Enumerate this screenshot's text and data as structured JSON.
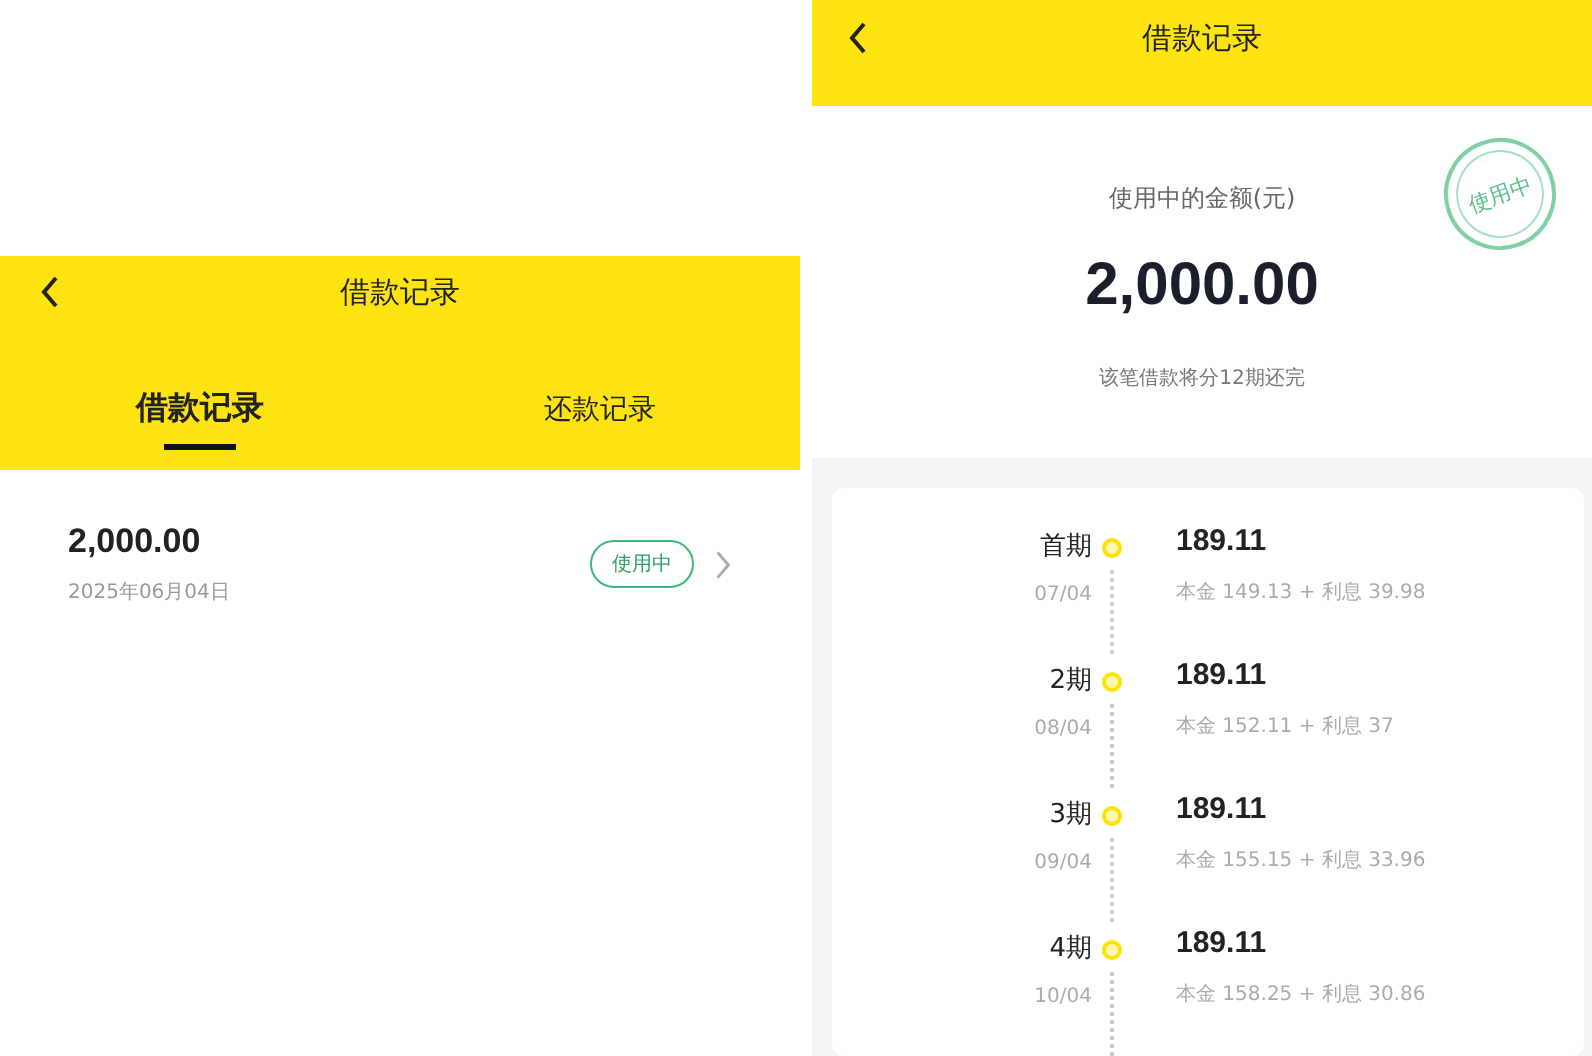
{
  "list_screen": {
    "title": "借款记录",
    "tabs": [
      {
        "label": "借款记录",
        "selected": true
      },
      {
        "label": "还款记录",
        "selected": false
      }
    ],
    "records": [
      {
        "amount": "2,000.00",
        "date": "2025年06月04日",
        "status": "使用中"
      }
    ]
  },
  "detail_screen": {
    "title": "借款记录",
    "stamp": "使用中",
    "amount_label": "使用中的金额(元)",
    "amount": "2,000.00",
    "note": "该笔借款将分12期还完",
    "installments": [
      {
        "period": "首期",
        "date": "07/04",
        "amount": "189.11",
        "breakdown": "本金 149.13 + 利息 39.98"
      },
      {
        "period": "2期",
        "date": "08/04",
        "amount": "189.11",
        "breakdown": "本金 152.11 + 利息 37"
      },
      {
        "period": "3期",
        "date": "09/04",
        "amount": "189.11",
        "breakdown": "本金 155.15 + 利息 33.96"
      },
      {
        "period": "4期",
        "date": "10/04",
        "amount": "189.11",
        "breakdown": "本金 158.25 + 利息 30.86"
      }
    ]
  }
}
